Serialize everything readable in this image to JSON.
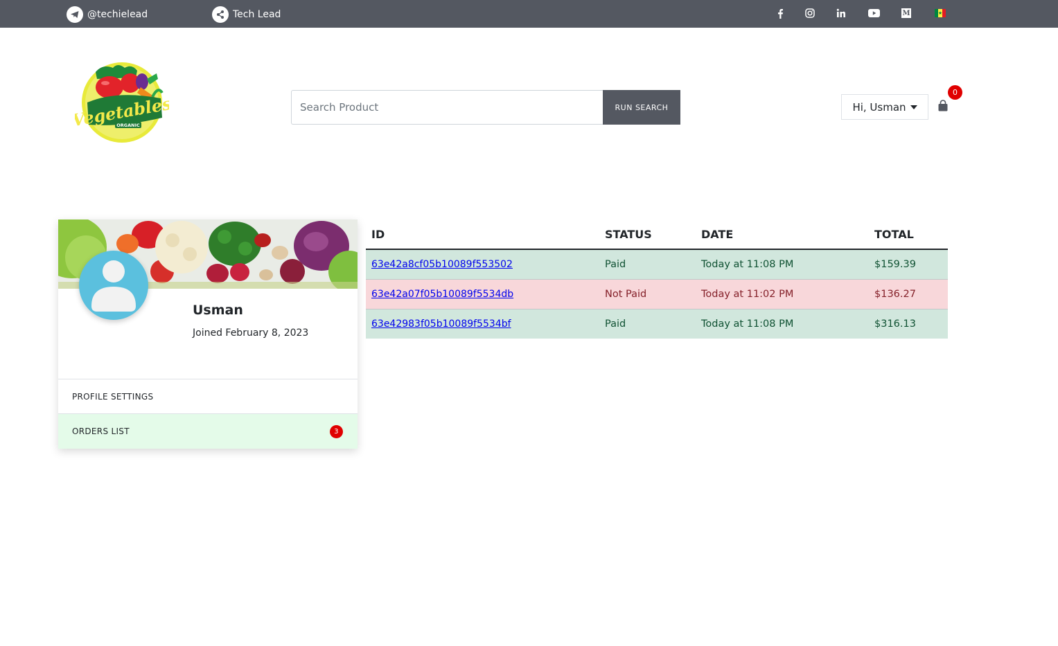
{
  "topbar": {
    "telegram_handle": "@techielead",
    "share_label": "Tech Lead",
    "socials": [
      "facebook",
      "instagram",
      "linkedin",
      "youtube",
      "medium",
      "language-flag"
    ],
    "medium_letter": "M"
  },
  "header": {
    "logo_text": "Vegetables",
    "logo_subtext": "ORGANIC",
    "search": {
      "placeholder": "Search Product",
      "value": ""
    },
    "search_button": "RUN SEARCH",
    "user_greeting": "Hi, Usman",
    "cart_count": "0"
  },
  "profile": {
    "name": "Usman",
    "joined": "Joined February 8, 2023",
    "menu": [
      {
        "label": "PROFILE SETTINGS"
      },
      {
        "label": "ORDERS LIST",
        "badge": "3"
      }
    ]
  },
  "orders": {
    "headers": [
      "ID",
      "STATUS",
      "DATE",
      "TOTAL"
    ],
    "rows": [
      {
        "id": "63e42a8cf05b10089f553502",
        "status": "Paid",
        "date": "Today at 11:08 PM",
        "total": "$159.39"
      },
      {
        "id": "63e42a07f05b10089f5534db",
        "status": "Not Paid",
        "date": "Today at 11:02 PM",
        "total": "$136.27"
      },
      {
        "id": "63e42983f05b10089f5534bf",
        "status": "Paid",
        "date": "Today at 11:08 PM",
        "total": "$316.13"
      }
    ]
  },
  "colors": {
    "topbar": "#545861",
    "paid_row": "#d1e7dd",
    "unpaid_row": "#f8d7da",
    "badge": "#e00000",
    "avatar": "#5bc0de",
    "active_menu": "#e4fbe9"
  }
}
